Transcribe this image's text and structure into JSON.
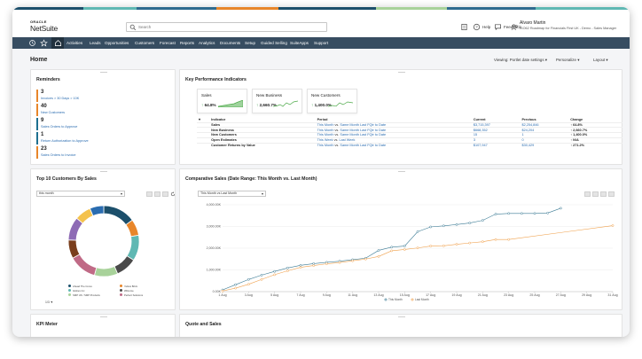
{
  "app": {
    "brand_top": "ORACLE",
    "brand_name": "NetSuite"
  },
  "search": {
    "placeholder": "Search"
  },
  "header": {
    "help": "Help",
    "feedback": "Feedback",
    "user_name": "Alvaro Martin",
    "user_role": "ISO62 Roadmap for Financials First UK - Demo - Sales Manager"
  },
  "nav": {
    "items": [
      "Activities",
      "Leads",
      "Opportunities",
      "Customers",
      "Forecast",
      "Reports",
      "Analytics",
      "Documents",
      "Setup",
      "Guided Selling",
      "SuiteApps",
      "Support"
    ]
  },
  "page": {
    "title": "Home",
    "view": "Viewing: Portlet date settings",
    "personalize": "Personalize",
    "layout": "Layout"
  },
  "reminders": {
    "title": "Reminders",
    "items": [
      {
        "count": "3",
        "label": "Invoices > 30 Days > 10K",
        "color": "#e8862a"
      },
      {
        "count": "40",
        "label": "New Customers",
        "color": "#e8862a"
      },
      {
        "count": "9",
        "label": "Sales Orders to Approve",
        "color": "#1d6f8f"
      },
      {
        "count": "1",
        "label": "Return Authorization to Approve",
        "color": "#1d6f8f"
      },
      {
        "count": "23",
        "label": "Sales Orders to Invoice",
        "color": "#e8862a"
      }
    ]
  },
  "kpi": {
    "title": "Key Performance Indicators",
    "cards": [
      {
        "title": "Sales",
        "value": "64.8%"
      },
      {
        "title": "New Business",
        "value": "2,660.7%"
      },
      {
        "title": "New Customers",
        "value": "1,400.0%"
      }
    ],
    "columns": [
      "Indicator",
      "Period",
      "Current",
      "Previous",
      "Change"
    ],
    "rows": [
      {
        "indicator": "Sales",
        "period_a": "This Month",
        "period_b": "Same Month Last FQtr to Date",
        "current": "$3,715,397",
        "previous": "$2,254,846",
        "change": "64.8%"
      },
      {
        "indicator": "New Business",
        "period_a": "This Month",
        "period_b": "Same Month Last FQtr to Date",
        "current": "$668,352",
        "previous": "$24,204",
        "change": "2,660.7%"
      },
      {
        "indicator": "New Customers",
        "period_a": "This Month",
        "period_b": "Same Month Last FQtr to Date",
        "current": "15",
        "previous": "1",
        "change": "1,400.0%"
      },
      {
        "indicator": "Open Estimates",
        "period_a": "This Week",
        "period_b": "Last Week",
        "current": "3",
        "previous": "0",
        "change": "N/A"
      },
      {
        "indicator": "Customer Returns by Value",
        "period_a": "This Month",
        "period_b": "Same Month Last FQtr to Date",
        "current": "$107,947",
        "previous": "$30,429",
        "change": "271.2%"
      }
    ]
  },
  "top10": {
    "title": "Top 10 Customers By Sales",
    "period": "this month",
    "legend": [
      "Ahead The Curve",
      "Yellow Brick",
      "Globex Inc",
      "Wilcome",
      "SMP UK / SMP Products",
      "Perfect Solutions"
    ],
    "pager": "1/3",
    "chart_data": {
      "type": "pie",
      "values": [
        14,
        7,
        11,
        9,
        10,
        12,
        8,
        10,
        7,
        6
      ],
      "colors": [
        "#1c4f6b",
        "#e8862a",
        "#5fb8b3",
        "#4a4a4a",
        "#a8d29a",
        "#c06a86",
        "#7a3e1c",
        "#8e6bb5",
        "#f4c24d",
        "#2a6cb0"
      ]
    }
  },
  "sales": {
    "title": "Comparative Sales (Date Range: This Month vs. Last Month)",
    "range": "This Month vs Last Month",
    "legend": [
      "This Month",
      "Last Month"
    ],
    "chart_data": {
      "type": "line",
      "y_ticks": [
        "0.00K",
        "1,000.00K",
        "2,000.00K",
        "3,000.00K",
        "4,000.00K"
      ],
      "x_ticks": [
        "1 Aug",
        "3 Aug",
        "5 Aug",
        "7 Aug",
        "9 Aug",
        "11 Aug",
        "13 Aug",
        "15 Aug",
        "17 Aug",
        "19 Aug",
        "21 Aug",
        "23 Aug",
        "25 Aug",
        "27 Aug",
        "29 Aug",
        "31 Aug"
      ],
      "x_range": [
        1,
        31
      ],
      "ylim": [
        0,
        4000
      ],
      "series": [
        {
          "name": "This Month",
          "color": "#3a7a94",
          "x": [
            1,
            2,
            3,
            4,
            5,
            6,
            7,
            8,
            9,
            10,
            11,
            12,
            13,
            14,
            15,
            16,
            17,
            18,
            19,
            20,
            21,
            22,
            23,
            24,
            25,
            26,
            27
          ],
          "y": [
            80,
            320,
            560,
            760,
            930,
            1090,
            1210,
            1290,
            1350,
            1400,
            1470,
            1540,
            1900,
            2050,
            2100,
            2760,
            2980,
            3030,
            3090,
            3160,
            3280,
            3570,
            3600,
            3600,
            3600,
            3620,
            3840
          ]
        },
        {
          "name": "Last Month",
          "color": "#f0a04b",
          "x": [
            1,
            2,
            3,
            4,
            5,
            6,
            7,
            8,
            9,
            10,
            11,
            12,
            13,
            14,
            15,
            16,
            17,
            18,
            19,
            20,
            21,
            22,
            23,
            31
          ],
          "y": [
            30,
            160,
            340,
            560,
            780,
            960,
            1120,
            1200,
            1280,
            1340,
            1420,
            1500,
            1620,
            1880,
            1940,
            2010,
            2100,
            2110,
            2180,
            2240,
            2300,
            2400,
            2400,
            3040
          ]
        }
      ]
    }
  },
  "kpi_meter": {
    "title": "KPI Meter"
  },
  "quote": {
    "title": "Quote and Sales"
  }
}
